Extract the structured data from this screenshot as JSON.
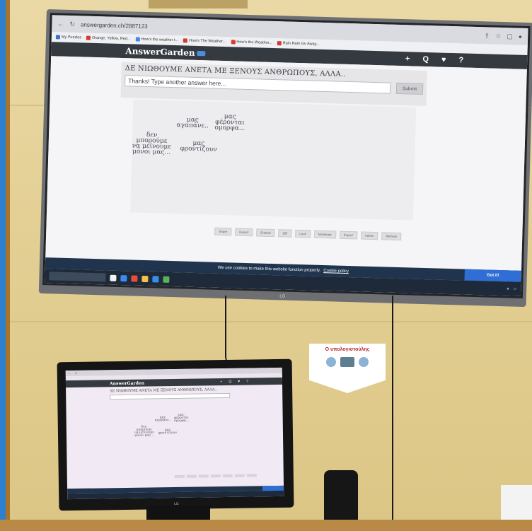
{
  "tv": {
    "url": "answergarden.ch/2887123",
    "bookmarks": [
      "My Puzzles",
      "Orange, Yellow, Red...",
      "How's the weather t...",
      "How's The Weather...",
      "How's the Weather...",
      "Rain Rain Go Away..."
    ],
    "brand": "AnswerGarden",
    "actions": [
      "+",
      "Q",
      "♥",
      "?"
    ],
    "question": "ΔΕ ΝΙΩΘΟΥΜΕ ΑΝΕΤΑ ΜΕ ΞΕΝΟΥΣ ΑΝΘΡΩΠΟΥΣ, ΑΛΛΑ..",
    "input_placeholder": "Thanks! Type another answer here...",
    "submit_label": "Submit",
    "words": [
      {
        "text": "μας\nαγαπάνε.."
      },
      {
        "text": "μας\nφέρονται\nόμορφα..."
      },
      {
        "text": "δεν\nμπορούμε\nνα μείνουμε\nμόνοι μας..."
      },
      {
        "text": "μας\nφροντίζουν"
      }
    ],
    "tools": [
      "Share",
      "Export",
      "Embed",
      "QR",
      "Lock",
      "Moderate",
      "Export",
      "Admin",
      "Refresh"
    ],
    "cookie_text": "We use cookies to make this website function properly.",
    "cookie_link": "Cookie policy",
    "cookie_ok": "Got it!",
    "logo": "LG"
  },
  "sign": {
    "title": "Ο υπολογιστούλης"
  },
  "monitor": {
    "brand": "AnswerGarden",
    "question": "ΔΕ ΝΙΩΘΟΥΜΕ ΑΝΕΤΑ ΜΕ ΞΕΝΟΥΣ ΑΝΘΡΩΠΟΥΣ, ΑΛΛΑ..",
    "logo": "LG"
  },
  "colors": {
    "wall": "#e3cf93",
    "ag_nav": "#343a40",
    "cookie_bar": "#20354d",
    "cookie_button": "#2f6ed4"
  }
}
